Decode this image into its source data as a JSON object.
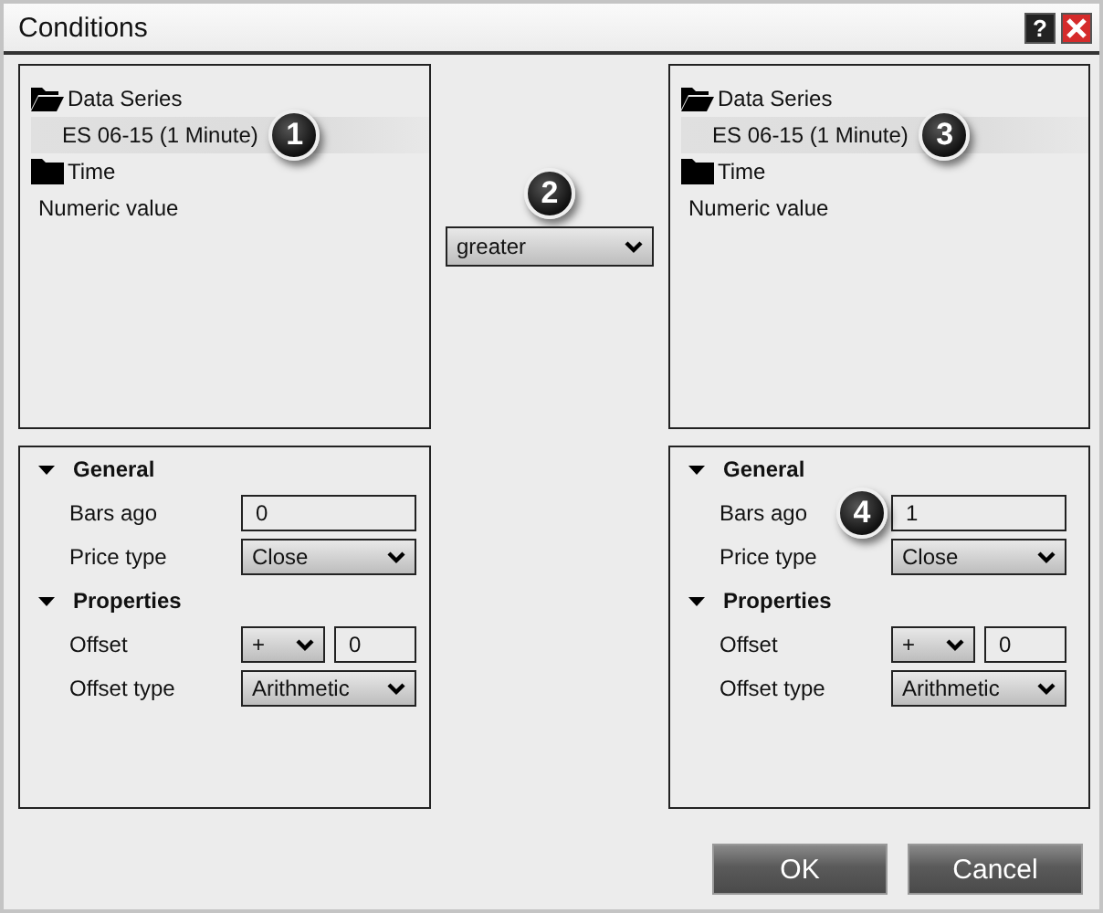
{
  "window": {
    "title": "Conditions",
    "help_label": "?"
  },
  "middle": {
    "callout": "2",
    "operator": "greater"
  },
  "sides": [
    {
      "tree": [
        {
          "kind": "folder",
          "label": "Data Series",
          "expanded": true,
          "selected": false,
          "children": [
            {
              "kind": "item",
              "label": "ES 06-15 (1 Minute)",
              "selected": true,
              "callout": "1"
            }
          ]
        },
        {
          "kind": "folder",
          "label": "Time",
          "expanded": false,
          "selected": false
        },
        {
          "kind": "leaf",
          "label": "Numeric value",
          "selected": false
        }
      ],
      "groups": [
        {
          "label": "General",
          "expanded": true,
          "rows": [
            {
              "label": "Bars ago",
              "kind": "text",
              "value": "0"
            },
            {
              "label": "Price type",
              "kind": "select",
              "value": "Close"
            }
          ]
        },
        {
          "label": "Properties",
          "expanded": true,
          "rows": [
            {
              "label": "Offset",
              "kind": "select_text",
              "value": "+",
              "value2": "0"
            },
            {
              "label": "Offset type",
              "kind": "select",
              "value": "Arithmetic"
            }
          ]
        }
      ]
    },
    {
      "tree": [
        {
          "kind": "folder",
          "label": "Data Series",
          "expanded": true,
          "selected": false,
          "children": [
            {
              "kind": "item",
              "label": "ES 06-15 (1 Minute)",
              "selected": true,
              "callout": "3"
            }
          ]
        },
        {
          "kind": "folder",
          "label": "Time",
          "expanded": false,
          "selected": false
        },
        {
          "kind": "leaf",
          "label": "Numeric value",
          "selected": false
        }
      ],
      "groups": [
        {
          "label": "General",
          "expanded": true,
          "rows": [
            {
              "label": "Bars ago",
              "kind": "text",
              "value": "1",
              "callout": "4"
            },
            {
              "label": "Price type",
              "kind": "select",
              "value": "Close"
            }
          ]
        },
        {
          "label": "Properties",
          "expanded": true,
          "rows": [
            {
              "label": "Offset",
              "kind": "select_text",
              "value": "+",
              "value2": "0"
            },
            {
              "label": "Offset type",
              "kind": "select",
              "value": "Arithmetic"
            }
          ]
        }
      ]
    }
  ],
  "buttons": [
    "OK",
    "Cancel"
  ]
}
